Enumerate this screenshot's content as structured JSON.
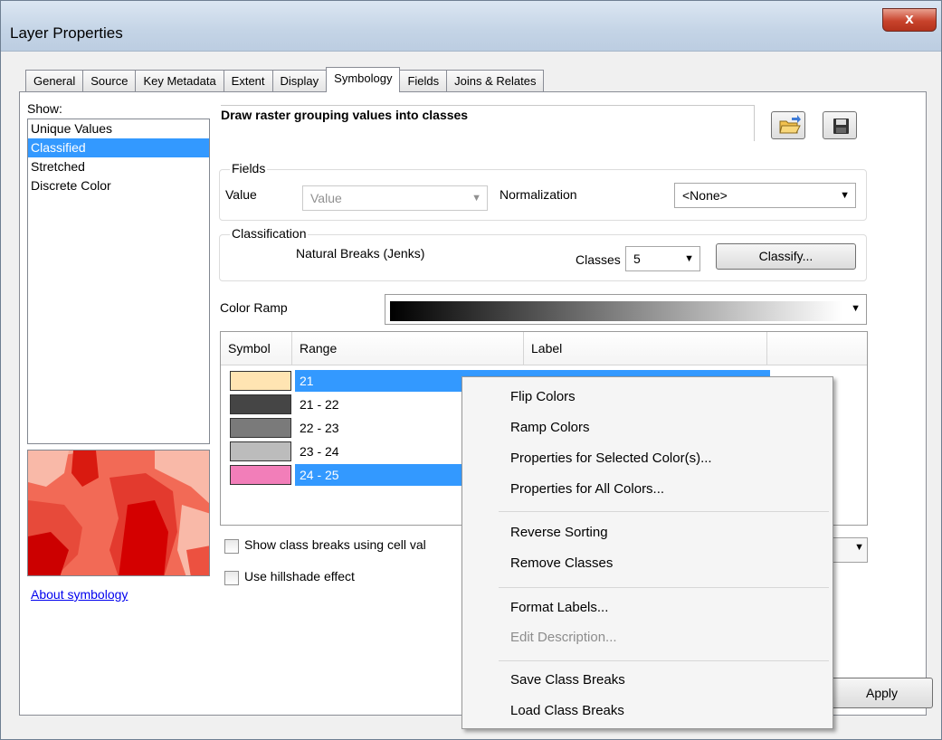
{
  "window": {
    "title": "Layer Properties",
    "close_label": "x"
  },
  "tabs": [
    "General",
    "Source",
    "Key Metadata",
    "Extent",
    "Display",
    "Symbology",
    "Fields",
    "Joins & Relates"
  ],
  "show": {
    "label": "Show:",
    "items": [
      "Unique Values",
      "Classified",
      "Stretched",
      "Discrete Color"
    ],
    "selected": "Classified"
  },
  "about_link": "About symbology",
  "description": "Draw raster grouping values into classes",
  "fields": {
    "group_label": "Fields",
    "value_label": "Value",
    "value_selected": "Value",
    "normalization_label": "Normalization",
    "normalization_selected": "<None>"
  },
  "classification": {
    "group_label": "Classification",
    "method": "Natural Breaks (Jenks)",
    "classes_label": "Classes",
    "classes_value": "5",
    "classify_button": "Classify..."
  },
  "color_ramp": {
    "label": "Color Ramp"
  },
  "table": {
    "headers": {
      "symbol": "Symbol",
      "range": "Range",
      "label": "Label"
    },
    "rows": [
      {
        "range": "21",
        "color": "#ffe4b2",
        "selected": true
      },
      {
        "range": "21 - 22",
        "color": "#454545",
        "selected": false
      },
      {
        "range": "22 - 23",
        "color": "#7a7a7a",
        "selected": false
      },
      {
        "range": "23 - 24",
        "color": "#bcbcbc",
        "selected": false
      },
      {
        "range": "24 - 25",
        "color": "#f27eb9",
        "selected": true
      }
    ]
  },
  "options": {
    "cell_values": "Show class breaks using cell val",
    "hillshade": "Use hillshade effect"
  },
  "apply_button": "Apply",
  "context_menu": {
    "flip": "Flip Colors",
    "ramp": "Ramp Colors",
    "props_selected": "Properties for Selected Color(s)...",
    "props_all": "Properties for All Colors...",
    "reverse": "Reverse Sorting",
    "remove": "Remove Classes",
    "format": "Format Labels...",
    "edit_desc": "Edit Description...",
    "save": "Save Class Breaks",
    "load": "Load Class Breaks"
  },
  "colors": {
    "selection": "#3399ff",
    "link": "#0000ee"
  }
}
